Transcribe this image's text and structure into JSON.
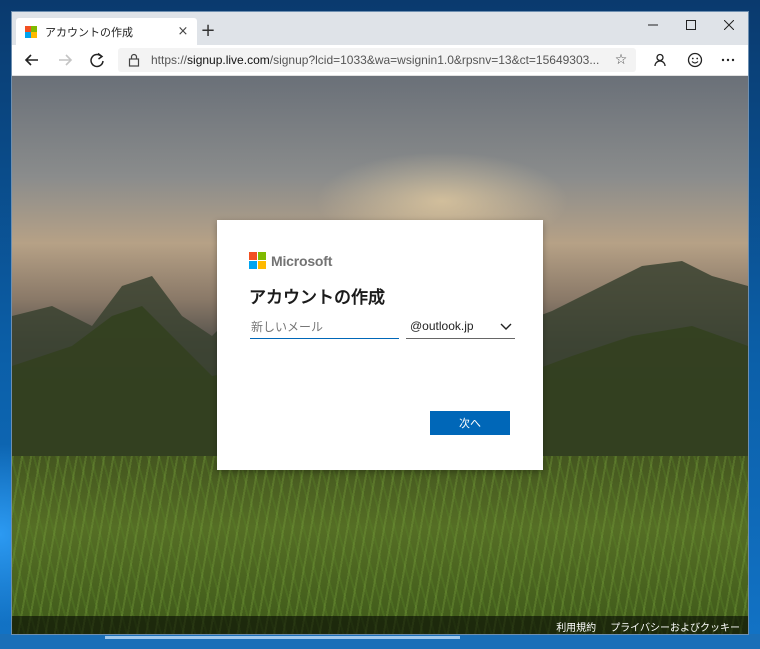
{
  "browser": {
    "tab_title": "アカウントの作成",
    "tab_close": "×",
    "new_tab": "+",
    "url_scheme": "https://",
    "url_host": "signup.live.com",
    "url_rest": "/signup?lcid=1033&wa=wsignin1.0&rpsnv=13&ct=15649303...",
    "icons": {
      "back": "back-arrow-icon",
      "forward": "forward-arrow-icon",
      "refresh": "refresh-icon",
      "lock": "lock-icon",
      "favorite": "star-icon",
      "profile": "profile-icon",
      "feedback": "smiley-icon",
      "menu": "more-icon"
    },
    "window_controls": {
      "minimize": "—",
      "maximize": "☐",
      "close": "✕"
    }
  },
  "signup": {
    "brand": "Microsoft",
    "title": "アカウントの作成",
    "email_placeholder": "新しいメール",
    "domain_value": "@outlook.jp",
    "next_label": "次へ"
  },
  "footer": {
    "terms": "利用規約",
    "privacy": "プライバシーおよびクッキー"
  },
  "colors": {
    "ms_red": "#f25022",
    "ms_green": "#7fba00",
    "ms_blue": "#00a4ef",
    "ms_yellow": "#ffb900",
    "accent": "#0067b8"
  }
}
